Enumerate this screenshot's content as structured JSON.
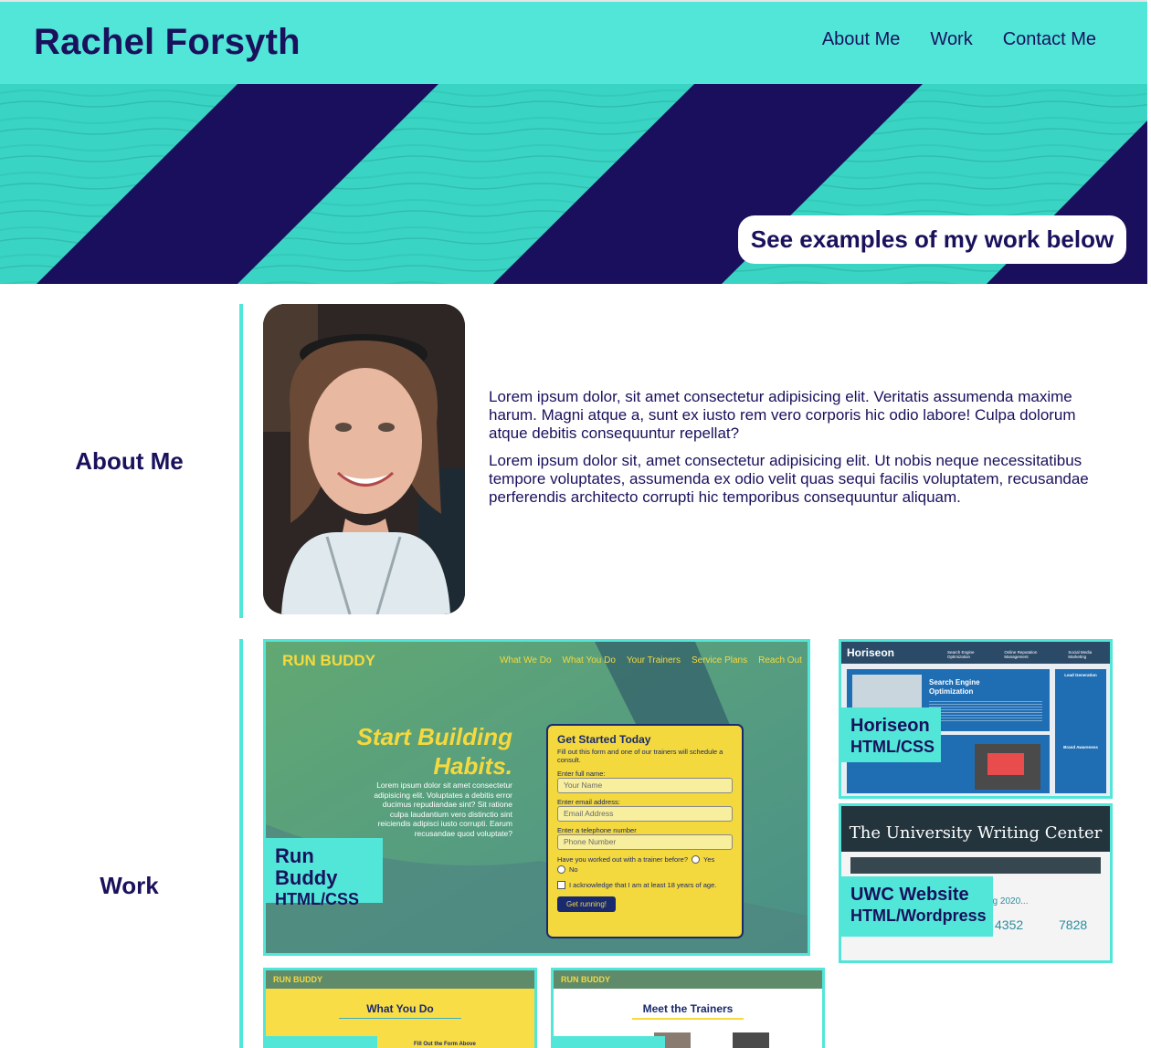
{
  "header": {
    "title": "Rachel Forsyth",
    "nav": [
      "About Me",
      "Work",
      "Contact Me"
    ]
  },
  "hero": {
    "cta": "See examples of my work below"
  },
  "about": {
    "heading": "About Me",
    "paragraphs": [
      "Lorem ipsum dolor, sit amet consectetur adipisicing elit. Veritatis assumenda maxime harum. Magni atque a, sunt ex iusto rem vero corporis hic odio labore! Culpa dolorum atque debitis consequuntur repellat?",
      "Lorem ipsum dolor sit, amet consectetur adipisicing elit. Ut nobis neque necessitatibus tempore voluptates, assumenda ex odio velit quas sequi facilis voluptatem, recusandae perferendis architecto corrupti hic temporibus consequuntur aliquam."
    ]
  },
  "work": {
    "heading": "Work",
    "projects": [
      {
        "title": "Run Buddy",
        "subtitle": "HTML/CSS",
        "preview": {
          "brand": "RUN BUDDY",
          "nav": [
            "What We Do",
            "What You Do",
            "Your Trainers",
            "Service Plans",
            "Reach Out"
          ],
          "headline1": "Start Building",
          "headline2": "Habits.",
          "blurb": "Lorem ipsum dolor sit amet consectetur adipisicing elit. Voluptates a debitis error ducimus repudiandae sint? Sit ratione culpa laudantium vero distinctio sint reiciendis adipisci iusto corrupti. Earum recusandae quod voluptate?",
          "form_title": "Get Started Today",
          "form_intro": "Fill out this form and one of our trainers will schedule a consult.",
          "fields": [
            {
              "label": "Enter full name:",
              "placeholder": "Your Name"
            },
            {
              "label": "Enter email address:",
              "placeholder": "Email Address"
            },
            {
              "label": "Enter a telephone number",
              "placeholder": "Phone Number"
            }
          ],
          "question": "Have you worked out with a trainer before?",
          "opt_yes": "Yes",
          "opt_no": "No",
          "ack": "I acknowledge that I am at least 18 years of age.",
          "submit": "Get running!"
        }
      },
      {
        "title": "Horiseon",
        "subtitle": "HTML/CSS",
        "preview": {
          "brand": "Horiseon",
          "nav": [
            "Search Engine Optimization",
            "Online Reputation Management",
            "Social Media Marketing"
          ],
          "tile_title": "Search Engine Optimization",
          "side_title1": "Lead Generation",
          "side_title2": "Brand Awareness"
        }
      },
      {
        "title": "UWC Website",
        "subtitle": "HTML/Wordpress",
        "preview": {
          "banner": "The University Writing Center",
          "year": "ng 2020...",
          "stats": [
            "4352",
            "7828"
          ]
        }
      },
      {
        "preview": {
          "brand": "RUN BUDDY",
          "heading": "What You Do",
          "caption": "Fill Out the Form Above"
        }
      },
      {
        "preview": {
          "brand": "RUN BUDDY",
          "heading": "Meet the Trainers"
        }
      }
    ]
  }
}
